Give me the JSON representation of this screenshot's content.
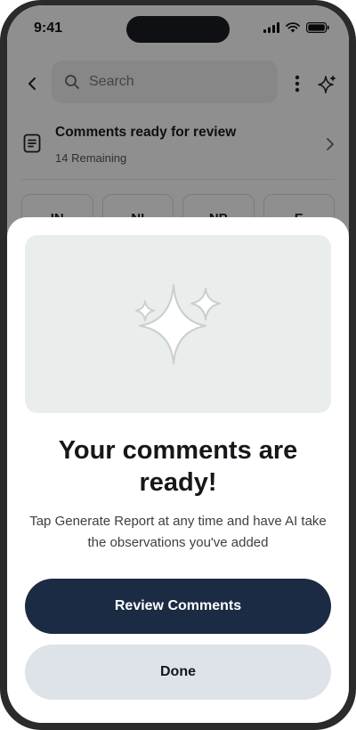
{
  "status_bar": {
    "time": "9:41"
  },
  "search": {
    "placeholder": "Search"
  },
  "review_banner": {
    "title": "Comments ready for review",
    "subtitle": "14 Remaining"
  },
  "chips": [
    "IN",
    "NI",
    "NP",
    "E"
  ],
  "sheet": {
    "title": "Your comments are ready!",
    "description": "Tap Generate Report at any time and have AI take the observations you've added",
    "primary_button": "Review Comments",
    "secondary_button": "Done"
  },
  "colors": {
    "primary": "#1c2b44",
    "secondary": "#dde3e9",
    "hero_bg": "#e9edeb"
  }
}
